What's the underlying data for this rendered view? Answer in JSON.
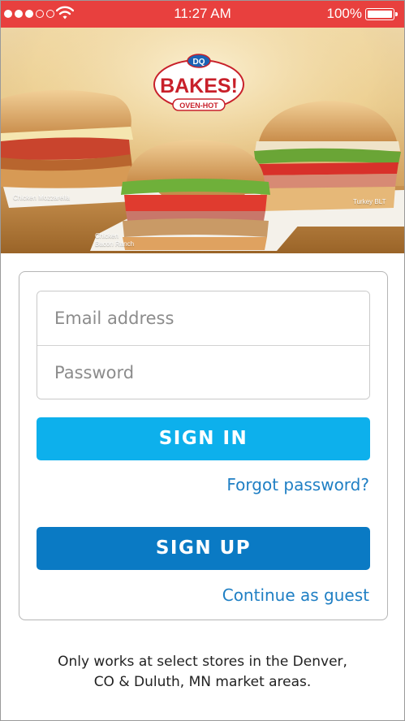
{
  "status_bar": {
    "time": "11:27 AM",
    "battery_percent": "100%",
    "signal_bars_filled": 3,
    "signal_bars_total": 5
  },
  "hero": {
    "logo_brand": "DQ",
    "logo_title": "BAKES!",
    "logo_subtitle": "OVEN-HOT",
    "labels": {
      "left": "Chicken Mozzarella",
      "center_line1": "Chicken",
      "center_line2": "Bacon Ranch",
      "right": "Turkey BLT"
    }
  },
  "login": {
    "email_placeholder": "Email address",
    "password_placeholder": "Password",
    "sign_in_label": "SIGN IN",
    "forgot_password_label": "Forgot password?",
    "sign_up_label": "SIGN UP",
    "continue_guest_label": "Continue as guest"
  },
  "footer": {
    "line1": "Only works at select stores in the Denver,",
    "line2": "CO & Duluth, MN market areas."
  },
  "colors": {
    "status_bar": "#e8403e",
    "sign_in_button": "#0db0ec",
    "sign_up_button": "#0a7ac4",
    "link": "#1f7fc4",
    "brand_red": "#c8202a"
  }
}
